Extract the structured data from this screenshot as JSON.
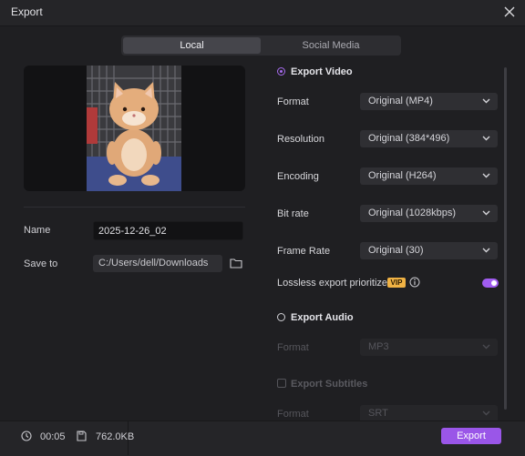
{
  "window": {
    "title": "Export"
  },
  "tabs": [
    {
      "label": "Local",
      "active": true
    },
    {
      "label": "Social Media",
      "active": false
    }
  ],
  "left": {
    "name_label": "Name",
    "name_value": "2025-12-26_02",
    "saveto_label": "Save to",
    "saveto_value": "C:/Users/dell/Downloads"
  },
  "export_video": {
    "label": "Export Video",
    "selected": true,
    "rows": [
      {
        "label": "Format",
        "value": "Original (MP4)"
      },
      {
        "label": "Resolution",
        "value": "Original (384*496)"
      },
      {
        "label": "Encoding",
        "value": "Original (H264)"
      },
      {
        "label": "Bit rate",
        "value": "Original (1028kbps)"
      },
      {
        "label": "Frame Rate",
        "value": "Original (30)"
      }
    ],
    "lossless_label": "Lossless export prioritized",
    "vip_badge": "VIP",
    "lossless_enabled": true
  },
  "export_audio": {
    "label": "Export Audio",
    "selected": false,
    "format_label": "Format",
    "format_value": "MP3"
  },
  "export_subtitles": {
    "label": "Export Subtitles",
    "checked": false,
    "format_label": "Format",
    "format_value": "SRT"
  },
  "footer": {
    "duration": "00:05",
    "filesize": "762.0KB",
    "export_label": "Export"
  },
  "colors": {
    "accent": "#a05cf0",
    "vip": "#f0b244",
    "background": "#1f1f22"
  }
}
